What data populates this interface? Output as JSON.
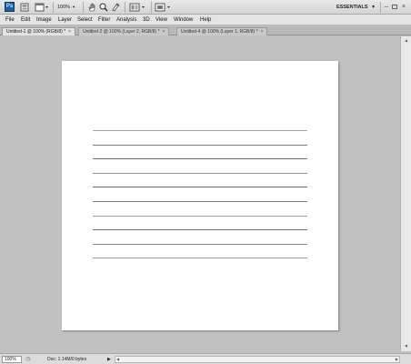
{
  "appbar": {
    "logo_text": "Ps",
    "icons": [
      "br-icon",
      "mini-bridge-icon",
      "arrange-icon",
      "hand-icon",
      "zoom-icon",
      "rotate-icon",
      "screen-mode-icon",
      "extras-icon"
    ],
    "zoom_value": "100%",
    "workspace_label": "ESSENTIALS",
    "window_controls": [
      "minimize",
      "restore",
      "close"
    ]
  },
  "menu": {
    "items": [
      "File",
      "Edit",
      "Image",
      "Layer",
      "Select",
      "Filter",
      "Analysis",
      "3D",
      "View",
      "Window",
      "Help"
    ]
  },
  "tabs": [
    {
      "label": "Untitled-1 @ 100% (RGB/8) *",
      "active": true
    },
    {
      "label": "Untitled-2 @ 100% (Layer 2, RGB/8) *",
      "active": false
    },
    {
      "label": "Untitled-4 @ 100% (Layer 1, RGB/8) *",
      "active": false
    }
  ],
  "tab_close_glyph": "×",
  "canvas": {
    "line_count": 10,
    "line_colors": [
      "#a6a6a6",
      "#7a7a7a",
      "#6e6e6e",
      "#9a9a9a",
      "#6a6a6a",
      "#7e7e7e",
      "#a4a4a4",
      "#6c6c6c",
      "#8a8a8a",
      "#9c9c9c"
    ]
  },
  "status": {
    "zoom_value": "100%",
    "doc_info": "Doc: 1.14M/0 bytes"
  },
  "colors": {
    "workspace_bg": "#c1c1c1",
    "canvas_bg": "#ffffff",
    "logo_blue": "#1b5f9e"
  }
}
